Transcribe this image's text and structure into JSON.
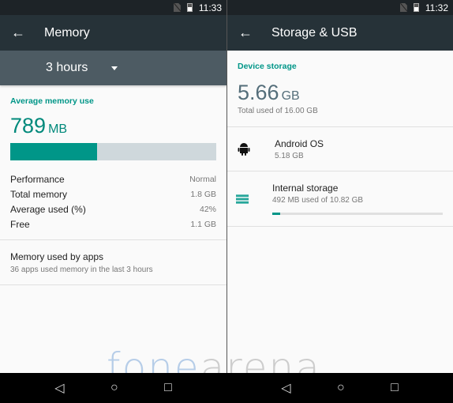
{
  "left": {
    "status": {
      "time": "11:33"
    },
    "toolbar": {
      "title": "Memory"
    },
    "spinner": {
      "selected": "3 hours"
    },
    "average": {
      "label": "Average memory use",
      "value": "789",
      "unit": "MB",
      "usage_fraction": 0.42
    },
    "stats": [
      {
        "key": "Performance",
        "value": "Normal"
      },
      {
        "key": "Total memory",
        "value": "1.8 GB"
      },
      {
        "key": "Average used (%)",
        "value": "42%"
      },
      {
        "key": "Free",
        "value": "1.1 GB"
      }
    ],
    "apps": {
      "title": "Memory used by apps",
      "subtitle": "36 apps used memory in the last 3 hours"
    }
  },
  "right": {
    "status": {
      "time": "11:32"
    },
    "toolbar": {
      "title": "Storage & USB"
    },
    "device": {
      "label": "Device storage",
      "value": "5.66",
      "unit": "GB",
      "subtitle": "Total used of 16.00 GB"
    },
    "android_os": {
      "title": "Android OS",
      "size": "5.18 GB"
    },
    "internal": {
      "title": "Internal storage",
      "subtitle": "492 MB used of 10.82 GB",
      "usage_fraction": 0.045
    }
  },
  "watermark": {
    "part1": "fone",
    "part2": "arena"
  },
  "nav": {
    "back": "◁",
    "home": "○",
    "recents": "□"
  }
}
